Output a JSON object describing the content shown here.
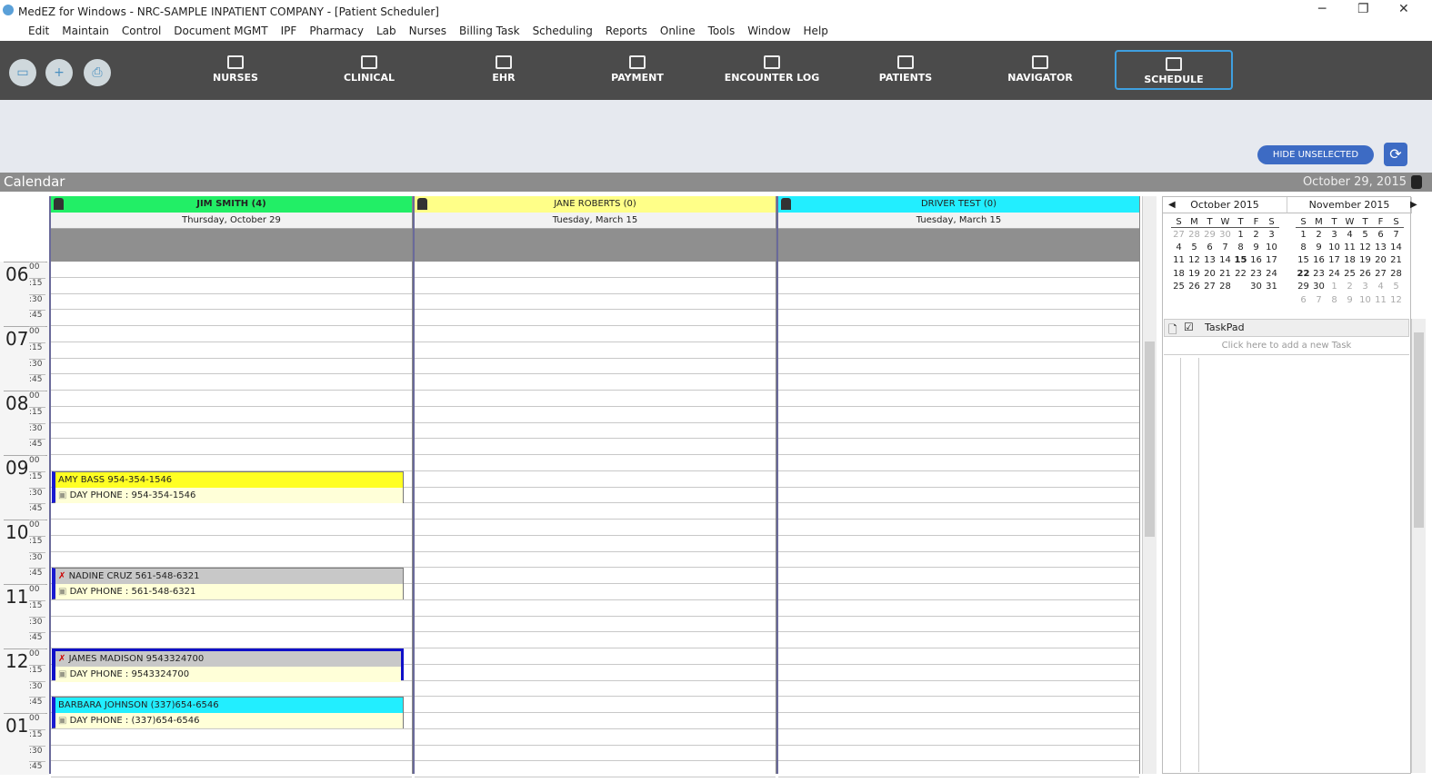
{
  "window": {
    "title": "MedEZ for Windows - NRC-SAMPLE INPATIENT COMPANY - [Patient Scheduler]"
  },
  "menu": [
    "Edit",
    "Maintain",
    "Control",
    "Document MGMT",
    "IPF",
    "Pharmacy",
    "Lab",
    "Nurses",
    "Billing Task",
    "Scheduling",
    "Reports",
    "Online",
    "Tools",
    "Window",
    "Help"
  ],
  "toolbar": [
    {
      "label": "NURSES",
      "icon": "nurses-icon"
    },
    {
      "label": "CLINICAL",
      "icon": "clinical-icon"
    },
    {
      "label": "EHR",
      "icon": "ehr-icon"
    },
    {
      "label": "PAYMENT",
      "icon": "payment-icon"
    },
    {
      "label": "ENCOUNTER LOG",
      "icon": "encounter-log-icon"
    },
    {
      "label": "PATIENTS",
      "icon": "patients-icon"
    },
    {
      "label": "NAVIGATOR",
      "icon": "navigator-icon"
    },
    {
      "label": "SCHEDULE",
      "icon": "schedule-icon",
      "selected": true
    }
  ],
  "hide_unselected": "HIDE UNSELECTED",
  "calendar": {
    "title": "Calendar",
    "date": "October 29, 2015"
  },
  "columns": [
    {
      "name": "JIM SMITH (4)",
      "date": "Thursday, October 29",
      "color": "#22ee66"
    },
    {
      "name": "JANE ROBERTS (0)",
      "date": "Tuesday, March 15",
      "color": "#ffff88"
    },
    {
      "name": "DRIVER TEST (0)",
      "date": "Tuesday, March 15",
      "color": "#22eeff"
    }
  ],
  "hours": [
    "06",
    "07",
    "08",
    "09",
    "10",
    "11",
    "12",
    "01"
  ],
  "minutes": [
    "00",
    ":15",
    ":30",
    ":45"
  ],
  "appointments": [
    {
      "line1": "AMY BASS  954-354-1546",
      "line2": "DAY PHONE  : 954-354-1546",
      "color": "#ffff22",
      "start": "09:15",
      "selected": false,
      "noshow": false
    },
    {
      "line1": "NADINE CRUZ  561-548-6321",
      "line2": "DAY PHONE  : 561-548-6321",
      "color": "#c8c8c8",
      "start": "10:45",
      "selected": false,
      "noshow": true
    },
    {
      "line1": "JAMES MADISON  9543324700",
      "line2": "DAY PHONE  : 9543324700",
      "color": "#c8c8c8",
      "start": "12:00",
      "selected": true,
      "noshow": true
    },
    {
      "line1": "BARBARA JOHNSON  (337)654-6546",
      "line2": "DAY PHONE  : (337)654-6546",
      "color": "#22eeff",
      "start": "12:45",
      "selected": false,
      "noshow": false
    }
  ],
  "mini_calendars": [
    {
      "title": "October 2015",
      "days": [
        "S",
        "M",
        "T",
        "W",
        "T",
        "F",
        "S"
      ],
      "weeks": [
        [
          "27",
          "28",
          "29",
          "30",
          "1",
          "2",
          "3"
        ],
        [
          "4",
          "5",
          "6",
          "7",
          "8",
          "9",
          "10"
        ],
        [
          "11",
          "12",
          "13",
          "14",
          "15",
          "16",
          "17"
        ],
        [
          "18",
          "19",
          "20",
          "21",
          "22",
          "23",
          "24"
        ],
        [
          "25",
          "26",
          "27",
          "28",
          "",
          "30",
          "31"
        ]
      ],
      "grey": [
        "0-0",
        "0-1",
        "0-2",
        "0-3"
      ],
      "bold": [
        "2-4"
      ]
    },
    {
      "title": "November 2015",
      "days": [
        "S",
        "M",
        "T",
        "W",
        "T",
        "F",
        "S"
      ],
      "weeks": [
        [
          "1",
          "2",
          "3",
          "4",
          "5",
          "6",
          "7"
        ],
        [
          "8",
          "9",
          "10",
          "11",
          "12",
          "13",
          "14"
        ],
        [
          "15",
          "16",
          "17",
          "18",
          "19",
          "20",
          "21"
        ],
        [
          "22",
          "23",
          "24",
          "25",
          "26",
          "27",
          "28"
        ],
        [
          "29",
          "30",
          "1",
          "2",
          "3",
          "4",
          "5"
        ],
        [
          "6",
          "7",
          "8",
          "9",
          "10",
          "11",
          "12"
        ]
      ],
      "grey": [
        "4-2",
        "4-3",
        "4-4",
        "4-5",
        "4-6",
        "5-0",
        "5-1",
        "5-2",
        "5-3",
        "5-4",
        "5-5",
        "5-6"
      ],
      "bold": [
        "3-0"
      ]
    }
  ],
  "taskpad": {
    "title": "TaskPad",
    "placeholder": "Click here to add a new Task"
  }
}
